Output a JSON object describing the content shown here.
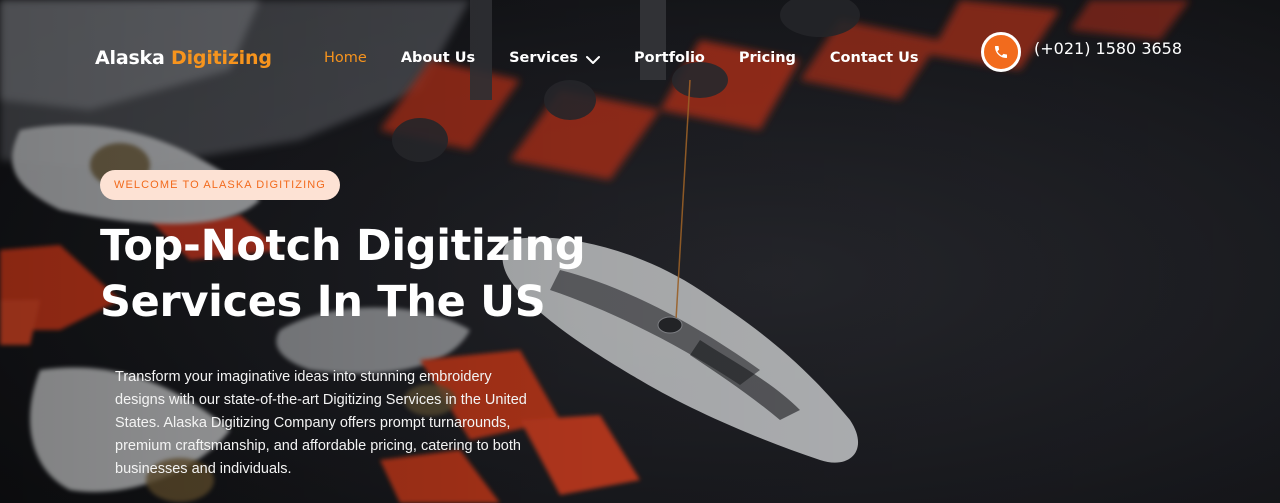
{
  "header": {
    "logo": {
      "part1": "Alaska",
      "part2": "Digitizing"
    },
    "nav": [
      {
        "label": "Home",
        "active": true
      },
      {
        "label": "About Us"
      },
      {
        "label": "Services",
        "has_dropdown": true
      },
      {
        "label": "Portfolio"
      },
      {
        "label": "Pricing"
      },
      {
        "label": "Contact Us"
      }
    ],
    "phone": {
      "icon": "phone-icon",
      "number": "(+021) 1580 3658"
    }
  },
  "hero": {
    "badge": "WELCOME TO ALASKA DIGITIZING",
    "headline_line1": "Top-Notch Digitizing",
    "headline_line2": "Services In The US",
    "description": "Transform your imaginative ideas into stunning embroidery designs with our state-of-the-art Digitizing Services in the United States. Alaska Digitizing Company offers prompt turnarounds, premium craftsmanship, and affordable pricing, catering to both businesses and individuals."
  },
  "colors": {
    "accent": "#f7941d",
    "phone_button": "#f26b1d",
    "badge_bg": "#fde2d4",
    "badge_text": "#f26b1d",
    "background": "#17181c"
  }
}
